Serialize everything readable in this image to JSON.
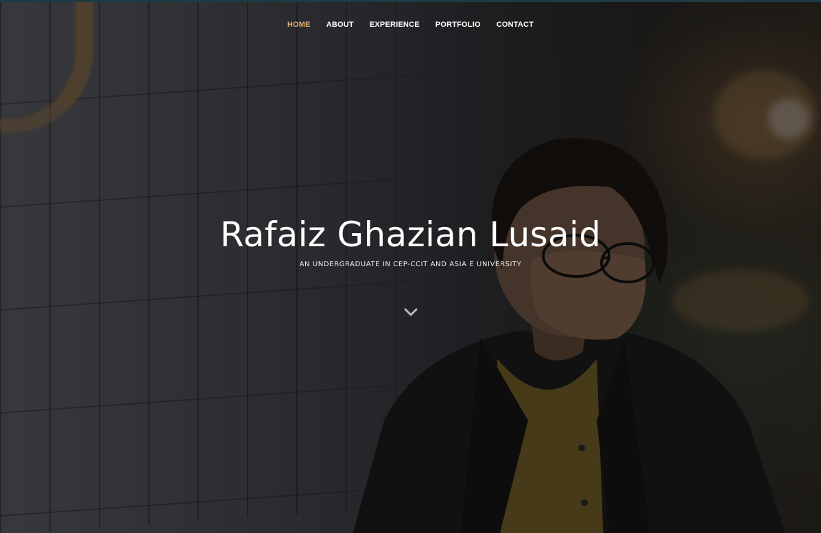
{
  "nav": {
    "items": [
      {
        "label": "HOME",
        "active": true
      },
      {
        "label": "ABOUT",
        "active": false
      },
      {
        "label": "EXPERIENCE",
        "active": false
      },
      {
        "label": "PORTFOLIO",
        "active": false
      },
      {
        "label": "CONTACT",
        "active": false
      }
    ]
  },
  "hero": {
    "title": "Rafaiz Ghazian Lusaid",
    "subtitle": "AN UNDERGRADUATE IN CEP-CCIT AND ASIA E UNIVERSITY",
    "scroll_icon": "chevron-down-icon"
  },
  "colors": {
    "accent": "#e0a872",
    "nav_text": "#ffffff",
    "title_text": "#ffffff"
  }
}
